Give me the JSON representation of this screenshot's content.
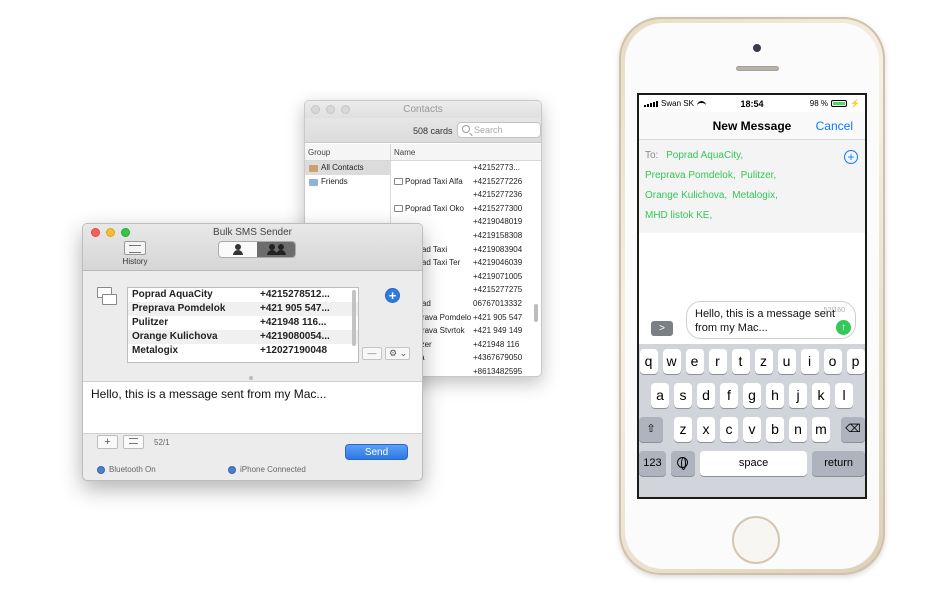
{
  "contacts_window": {
    "title": "Contacts",
    "card_count": "508 cards",
    "search_placeholder": "Search",
    "group_header": "Group",
    "name_header": "Name",
    "groups": [
      {
        "label": "All Contacts",
        "selected": true
      },
      {
        "label": "Friends",
        "selected": false
      }
    ],
    "rows": [
      {
        "name": "",
        "number": "+42152773..."
      },
      {
        "name": "Poprad Taxi Alfa",
        "number": "+4215277226"
      },
      {
        "name": "",
        "number": "+4215277236"
      },
      {
        "name": "Poprad Taxi Oko",
        "number": "+4215277300"
      },
      {
        "name": "",
        "number": "+4219048019"
      },
      {
        "name": "",
        "number": "+4219158308"
      },
      {
        "name": "Poprad Taxi",
        "number": "+4219083904"
      },
      {
        "name": "Poprad Taxi Ter",
        "number": "+4219046039"
      },
      {
        "name": "",
        "number": "+4219071005"
      },
      {
        "name": "",
        "number": "+4215277275"
      },
      {
        "name": "Poprad",
        "number": "06767013332"
      },
      {
        "name": "Preprava Pomdelok",
        "number": "+421 905 547"
      },
      {
        "name": "Preprava Stvrtok",
        "number": "+421 949 149"
      },
      {
        "name": "Pulitzer",
        "number": "+421948 116"
      },
      {
        "name": "Pyxia",
        "number": "+4367679050"
      },
      {
        "name": "",
        "number": "+8613482595"
      }
    ]
  },
  "bulk_window": {
    "title": "Bulk SMS Sender",
    "history_label": "History",
    "recipients": [
      {
        "name": "Poprad AquaCity",
        "number": "+4215278512..."
      },
      {
        "name": "Preprava Pomdelok",
        "number": "+421 905 547..."
      },
      {
        "name": "Pulitzer",
        "number": "+421948 116..."
      },
      {
        "name": "Orange Kulichova",
        "number": "+4219080054..."
      },
      {
        "name": "Metalogix",
        "number": "+12027190048"
      }
    ],
    "add_symbol": "+",
    "minus_symbol": "—",
    "gear_symbol": "⚙ ⌄",
    "message": "Hello, this is a message sent from my Mac...",
    "plus_button": "+",
    "char_count": "52/1",
    "send_label": "Send",
    "status_bluetooth": "Bluetooth On",
    "status_iphone": "iPhone Connected"
  },
  "iphone": {
    "carrier": "Swan SK",
    "time": "18:54",
    "battery_pct": "98 %",
    "battery_level": 0.98,
    "nav_title": "New Message",
    "cancel_label": "Cancel",
    "to_label": "To:",
    "recipients": [
      "Poprad AquaCity,",
      "Preprava Pomdelok,",
      "Pulitzer,",
      "Orange Kulichova,",
      "Metalogix,",
      "MHD listok KE,"
    ],
    "message": "Hello, this is a message sent from my Mac...",
    "counter": "52/160",
    "chevron": ">",
    "send_arrow": "↑",
    "keys_row1": [
      "q",
      "w",
      "e",
      "r",
      "t",
      "z",
      "u",
      "i",
      "o",
      "p"
    ],
    "keys_row2": [
      "a",
      "s",
      "d",
      "f",
      "g",
      "h",
      "j",
      "k",
      "l"
    ],
    "keys_row3": [
      "z",
      "x",
      "c",
      "v",
      "b",
      "n",
      "m"
    ],
    "shift_glyph": "⇧",
    "delete_glyph": "⌫",
    "key_123": "123",
    "key_space": "space",
    "key_return": "return"
  },
  "colors": {
    "accent_blue": "#0a7aff",
    "ios_green": "#34c759",
    "mac_send": "#2e78e4",
    "close_red": "#fc5f57",
    "minimize_yellow": "#fdbc2e",
    "zoom_green": "#33c748"
  }
}
